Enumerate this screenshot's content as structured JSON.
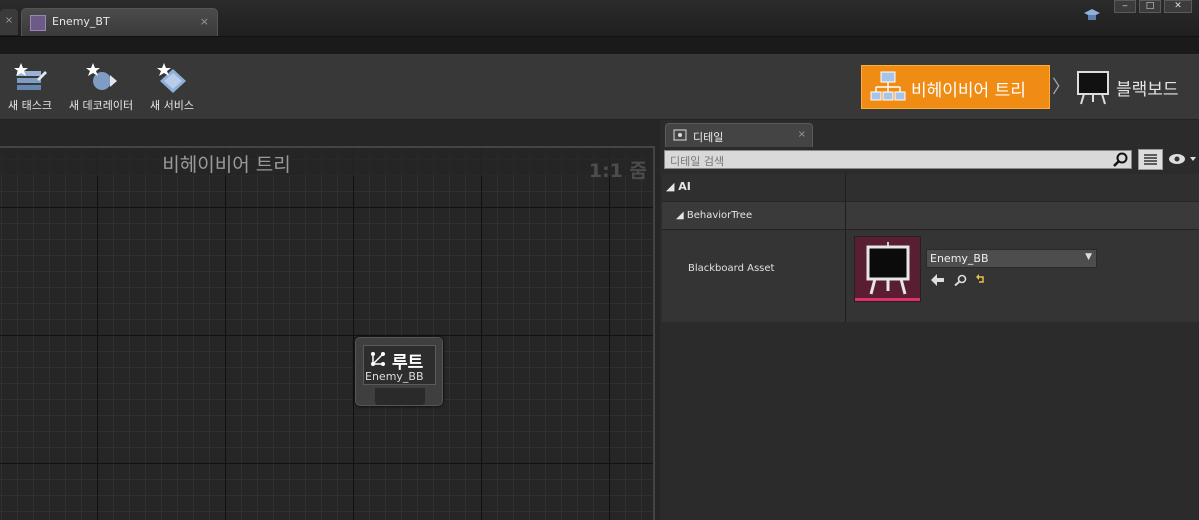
{
  "window": {
    "tab_prev_close": "×",
    "document_tab": {
      "label": "Enemy_BT",
      "close": "×"
    },
    "controls": {
      "minimize": "‒",
      "maximize": "□",
      "close": "✕"
    }
  },
  "toolbar": {
    "buttons": [
      {
        "label": "새 태스크",
        "icon": "new-task-icon"
      },
      {
        "label": "새 데코레이터",
        "icon": "new-decorator-icon"
      },
      {
        "label": "새 서비스",
        "icon": "new-service-icon"
      }
    ],
    "modes": {
      "behavior_tree": "비헤이비어 트리",
      "separator": "〉",
      "blackboard": "블랙보드"
    }
  },
  "graph": {
    "title": "비헤이비어 트리",
    "zoom": "1:1 줌",
    "root_node": {
      "label": "루트",
      "blackboard": "Enemy_BB"
    }
  },
  "details": {
    "tab_label": "디테일",
    "tab_close": "×",
    "search_placeholder": "디테일 검색",
    "sections": {
      "ai": "AI",
      "behavior_tree": "BehaviorTree"
    },
    "property": {
      "name": "Blackboard Asset",
      "value": "Enemy_BB"
    }
  },
  "colors": {
    "accent_mode": "#f08c14",
    "asset_thumbnail": "#5a1e32",
    "asset_bar": "#e0306a"
  }
}
